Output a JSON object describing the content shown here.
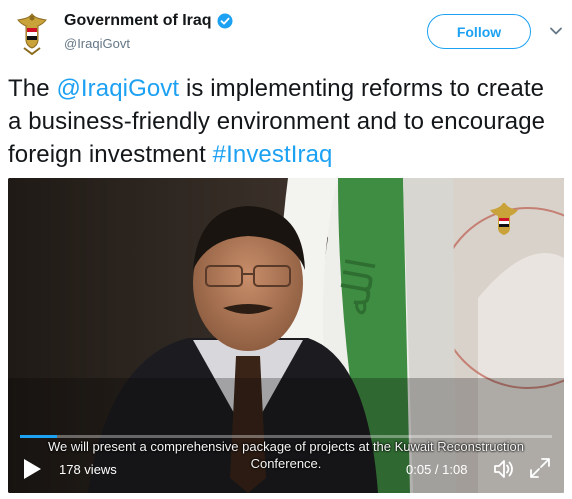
{
  "account": {
    "name": "Government of Iraq",
    "handle": "@IraqiGovt",
    "verified_icon": "verified-badge-icon",
    "avatar_icon": "iraq-eagle-emblem"
  },
  "follow_label": "Follow",
  "tweet": {
    "part1": "The ",
    "mention": "@IraqiGovt",
    "part2": " is implementing reforms to create a business-friendly environment and to encourage foreign investment ",
    "hashtag": "#InvestIraq"
  },
  "video": {
    "subtitle_line1": "We will present a comprehensive package of projects at the Kuwait Reconstruction",
    "subtitle_line2": "Conference.",
    "views": "178 views",
    "time": "0:05 / 1:08",
    "progress": 0.07
  },
  "colors": {
    "link": "#1da1f2",
    "text": "#14171a",
    "secondary": "#657786"
  }
}
